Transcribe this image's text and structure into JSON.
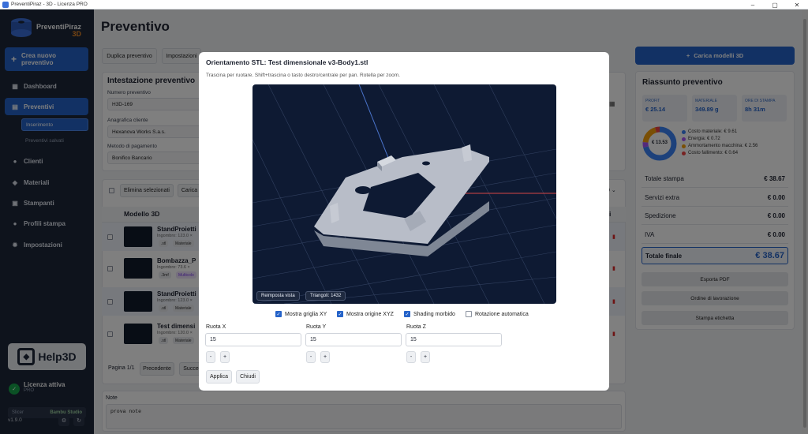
{
  "window": {
    "title": "PreventiPiraz - 3D - Licenza PRO",
    "min": "–",
    "max": "▢",
    "close": "✕"
  },
  "sidebar": {
    "logo_main": "PreventiPiraz",
    "logo_sub": "3D",
    "new_quote": "Crea nuovo preventivo",
    "items": [
      {
        "label": "Dashboard",
        "icon": "dashboard-icon"
      },
      {
        "label": "Preventivi",
        "icon": "document-icon"
      },
      {
        "label": "Clienti",
        "icon": "users-icon"
      },
      {
        "label": "Materiali",
        "icon": "cube-icon"
      },
      {
        "label": "Stampanti",
        "icon": "printer-icon"
      },
      {
        "label": "Profili stampa",
        "icon": "user-icon"
      },
      {
        "label": "Impostazioni",
        "icon": "gear-icon"
      }
    ],
    "subitems": [
      "Inserimento",
      "Preventivi salvati"
    ],
    "help": "Help3D",
    "license_title": "Licenza attiva",
    "license_plan": "PRO",
    "slicer_label": "Slicer",
    "slicer_value": "Bambu Studio",
    "version": "v1.9.0"
  },
  "main": {
    "title": "Preventivo",
    "toolbar": [
      "Duplica preventivo",
      "Impostazioni"
    ],
    "header_title": "Intestazione preventivo",
    "fields": [
      {
        "label": "Numero preventivo",
        "value": "H3D-169"
      },
      {
        "label": "Anagrafica cliente",
        "value": "Hexanova Works S.a.s."
      },
      {
        "label": "Metodo di pagamento",
        "value": "Bonifico Bancario"
      }
    ],
    "table_actions": [
      "Elimina selezionati",
      "Carica"
    ],
    "col_model": "Modello 3D",
    "rows": [
      {
        "name": "StandProietti",
        "sub": "Ingombro: 123.0 ×",
        "tags": [
          ".stl",
          "Materiale"
        ]
      },
      {
        "name": "Bombazza_P",
        "sub": "Ingombro: 73.6 ×",
        "tags": [
          ".3mf",
          "Multicolo"
        ]
      },
      {
        "name": "StandProietti",
        "sub": "Ingombro: 123.0 ×",
        "tags": [
          ".stl",
          "Materiale"
        ]
      },
      {
        "name": "Test dimensi",
        "sub": "Ingombro: 120.0 ×",
        "tags": [
          ".stl",
          "Materiale"
        ]
      }
    ],
    "pagination": {
      "label": "Pagina 1/1",
      "prev": "Precedente",
      "next": "Succe"
    },
    "notes_label": "Note",
    "notes_value": "prova note"
  },
  "summary": {
    "load_button": "Carica modelli 3D",
    "title": "Riassunto preventivo",
    "stats": [
      {
        "label": "PROFIT",
        "value": "€ 25.14"
      },
      {
        "label": "MATERIALE",
        "value": "349.89 g"
      },
      {
        "label": "ORE DI STAMPA",
        "value": "8h 31m"
      }
    ],
    "donut_center": "€ 13.53",
    "legend": [
      {
        "label": "Costo materiale: € 9.61",
        "color": "#3b82f6"
      },
      {
        "label": "Energia: € 0.72",
        "color": "#a855f7"
      },
      {
        "label": "Ammortamento macchina: € 2.56",
        "color": "#f59e0b"
      },
      {
        "label": "Costo fallimento: € 0.64",
        "color": "#ef4444"
      }
    ],
    "totals": [
      {
        "label": "Totale stampa",
        "value": "€ 38.67"
      },
      {
        "label": "Servizi extra",
        "value": "€ 0.00"
      },
      {
        "label": "Spedizione",
        "value": "€ 0.00"
      },
      {
        "label": "IVA",
        "value": "€ 0.00"
      }
    ],
    "final_label": "Totale finale",
    "final_value": "€ 38.67",
    "buttons": [
      "Esporta PDF",
      "Ordine di lavorazione",
      "Stampa etichetta"
    ]
  },
  "modal": {
    "title": "Orientamento STL: Test dimensionale v3-Body1.stl",
    "hint": "Trascina per ruotare. Shift+trascina o tasto destro/centrale per pan. Rotella per zoom.",
    "reset_view": "Reimposta vista",
    "triangles": "Triangoli: 1432",
    "options": [
      {
        "label": "Mostra griglia XY",
        "checked": true
      },
      {
        "label": "Mostra origine XYZ",
        "checked": true
      },
      {
        "label": "Shading morbido",
        "checked": true
      },
      {
        "label": "Rotazione automatica",
        "checked": false
      }
    ],
    "rotations": [
      {
        "label": "Ruota X",
        "value": "15"
      },
      {
        "label": "Ruota Y",
        "value": "15"
      },
      {
        "label": "Ruota Z",
        "value": "15"
      }
    ],
    "minus": "-",
    "plus": "+",
    "apply": "Applica",
    "close": "Chiudi"
  }
}
